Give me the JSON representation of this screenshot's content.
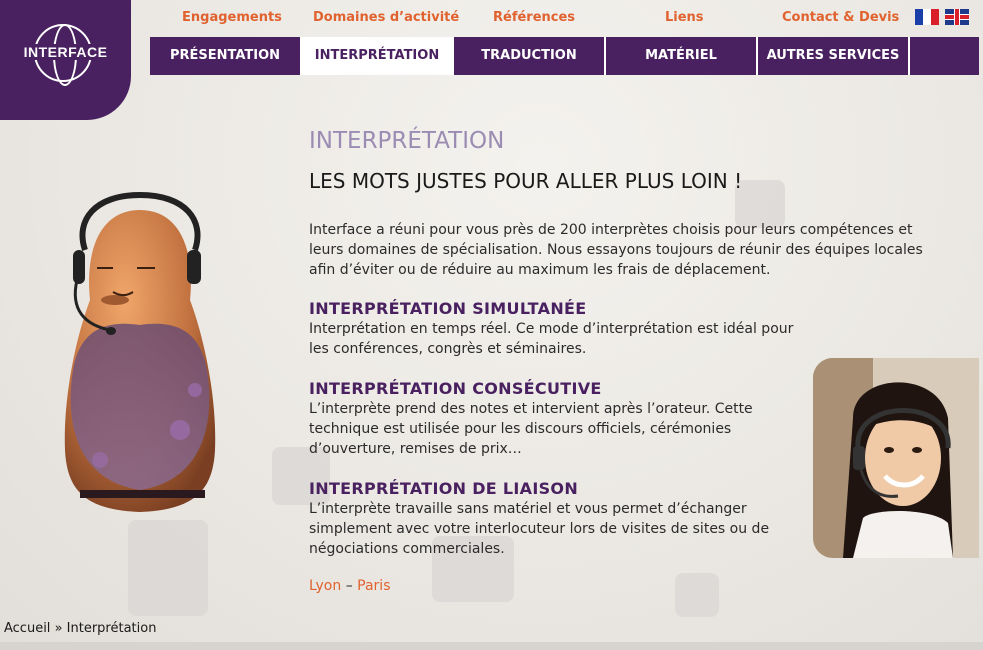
{
  "logo": {
    "text": "INTERFACE"
  },
  "top_nav": [
    {
      "label": "Engagements"
    },
    {
      "label": "Domaines d’activité"
    },
    {
      "label": "Références"
    },
    {
      "label": "Liens"
    },
    {
      "label": "Contact & Devis"
    }
  ],
  "languages": [
    {
      "icon": "flag-fr-icon"
    },
    {
      "icon": "flag-en-icon"
    }
  ],
  "main_nav": [
    {
      "label": "PRÉSENTATION",
      "active": false
    },
    {
      "label": "INTERPRÉTATION",
      "active": true
    },
    {
      "label": "TRADUCTION",
      "active": false
    },
    {
      "label": "MATÉRIEL",
      "active": false
    },
    {
      "label": "AUTRES SERVICES",
      "active": false
    }
  ],
  "page": {
    "section_title": "INTERPRÉTATION",
    "tagline": "LES MOTS JUSTES POUR ALLER PLUS LOIN !",
    "intro": [
      "Interface a réuni pour vous près de 200 interprètes choisis pour leurs compétences et",
      "leurs domaines de spécialisation. Nous essayons toujours de réunir des équipes locales",
      "afin d’éviter ou de réduire au maximum les frais de déplacement."
    ],
    "services": [
      {
        "title": "INTERPRÉTATION SIMULTANÉE",
        "lines": [
          "Interprétation en temps réel. Ce mode d’interprétation est idéal pour",
          "les conférences, congrès et séminaires."
        ]
      },
      {
        "title": "INTERPRÉTATION CONSÉCUTIVE",
        "lines": [
          "L’interprète prend des notes et intervient après l’orateur. Cette",
          "technique est utilisée pour les discours officiels, cérémonies",
          "d’ouverture, remises de prix…"
        ]
      },
      {
        "title": "INTERPRÉTATION DE LIAISON",
        "lines": [
          "L’interprète travaille sans matériel et vous permet d’échanger",
          "simplement avec votre interlocuteur lors de visites de sites ou de",
          "négociations commerciales."
        ]
      }
    ],
    "cities": {
      "first": "Lyon",
      "separator": "–",
      "second": "Paris"
    }
  },
  "breadcrumb": {
    "home": "Accueil",
    "separator": "»",
    "current": "Interprétation"
  },
  "colors": {
    "brand_purple": "#4a2160",
    "accent_orange": "#e0622f",
    "title_lilac": "#9b8cb3"
  }
}
